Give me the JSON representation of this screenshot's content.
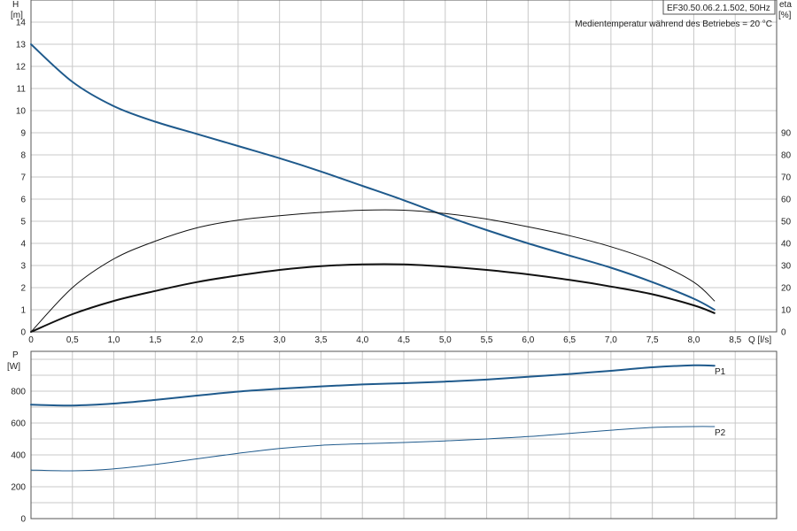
{
  "colors": {
    "grid": "#c8c8c8",
    "axis": "#555555",
    "blue": "#1f5a8c",
    "black": "#111111",
    "text": "#222222"
  },
  "header": {
    "model": "EF30.50.06.2.1.502, 50Hz",
    "note": "Medientemperatur während des Betriebes = 20 °C"
  },
  "chart_data": [
    {
      "type": "line",
      "panel": "head-efficiency",
      "xlabel": "Q [l/s]",
      "xlim": [
        0,
        9
      ],
      "x_ticks": [
        "0",
        "0,5",
        "1,0",
        "1,5",
        "2,0",
        "2,5",
        "3,0",
        "3,5",
        "4,0",
        "4,5",
        "5,0",
        "5,5",
        "6,0",
        "6,5",
        "7,0",
        "7,5",
        "8,0",
        "8,5"
      ],
      "ylabel_left": [
        "H",
        "[m]"
      ],
      "ylim_left": [
        0,
        15
      ],
      "y_ticks_left": [
        "0",
        "1",
        "2",
        "3",
        "4",
        "5",
        "6",
        "7",
        "8",
        "9",
        "10",
        "11",
        "12",
        "13",
        "14"
      ],
      "ylabel_right": [
        "eta",
        "[%]"
      ],
      "ylim_right": [
        0,
        150
      ],
      "y_ticks_right": [
        "0",
        "10",
        "20",
        "30",
        "40",
        "50",
        "60",
        "70",
        "80",
        "90"
      ],
      "grid": true,
      "series": [
        {
          "axis": "left",
          "color": "#1f5a8c",
          "width": 2,
          "x": [
            0,
            0.5,
            1.0,
            1.5,
            2.0,
            2.5,
            3.0,
            3.5,
            4.0,
            4.5,
            5.0,
            5.5,
            6.0,
            6.5,
            7.0,
            7.5,
            8.0,
            8.25
          ],
          "y": [
            13,
            11.3,
            10.2,
            9.5,
            8.95,
            8.4,
            7.85,
            7.25,
            6.6,
            5.95,
            5.25,
            4.6,
            4.0,
            3.45,
            2.9,
            2.25,
            1.5,
            1.0
          ]
        },
        {
          "axis": "right",
          "color": "#111111",
          "width": 1,
          "x": [
            0,
            0.5,
            1.0,
            1.5,
            2.0,
            2.5,
            3.0,
            3.5,
            4.0,
            4.5,
            5.0,
            5.5,
            6.0,
            6.5,
            7.0,
            7.5,
            8.0,
            8.25
          ],
          "y": [
            0,
            20,
            33,
            41,
            47,
            50.5,
            52.5,
            54,
            55,
            55,
            53.5,
            51,
            47.5,
            43.5,
            38.5,
            32,
            22.5,
            14
          ]
        },
        {
          "axis": "left",
          "color": "#111111",
          "width": 2,
          "x": [
            0,
            0.5,
            1.0,
            1.5,
            2.0,
            2.5,
            3.0,
            3.5,
            4.0,
            4.5,
            5.0,
            5.5,
            6.0,
            6.5,
            7.0,
            7.5,
            8.0,
            8.25
          ],
          "y": [
            0,
            0.8,
            1.4,
            1.85,
            2.25,
            2.55,
            2.8,
            2.97,
            3.05,
            3.05,
            2.95,
            2.8,
            2.6,
            2.35,
            2.05,
            1.7,
            1.2,
            0.85
          ]
        }
      ]
    },
    {
      "type": "line",
      "panel": "power",
      "xlim": [
        0,
        9
      ],
      "ylabel": [
        "P",
        "[W]"
      ],
      "ylim": [
        0,
        1050
      ],
      "y_ticks": [
        "0",
        "200",
        "400",
        "600",
        "800"
      ],
      "grid": true,
      "series": [
        {
          "name": "P1",
          "color": "#1f5a8c",
          "width": 2,
          "x": [
            0,
            0.5,
            1.0,
            1.5,
            2.0,
            2.5,
            3.0,
            3.5,
            4.0,
            4.5,
            5.0,
            5.5,
            6.0,
            6.5,
            7.0,
            7.5,
            8.0,
            8.25
          ],
          "y": [
            715,
            710,
            722,
            745,
            772,
            797,
            815,
            830,
            842,
            850,
            860,
            873,
            890,
            908,
            928,
            950,
            962,
            960
          ]
        },
        {
          "name": "P2",
          "color": "#1f5a8c",
          "width": 1,
          "x": [
            0,
            0.5,
            1.0,
            1.5,
            2.0,
            2.5,
            3.0,
            3.5,
            4.0,
            4.5,
            5.0,
            5.5,
            6.0,
            6.5,
            7.0,
            7.5,
            8.0,
            8.25
          ],
          "y": [
            305,
            300,
            312,
            340,
            375,
            410,
            440,
            460,
            470,
            478,
            488,
            500,
            515,
            535,
            555,
            572,
            578,
            578
          ]
        }
      ]
    }
  ]
}
